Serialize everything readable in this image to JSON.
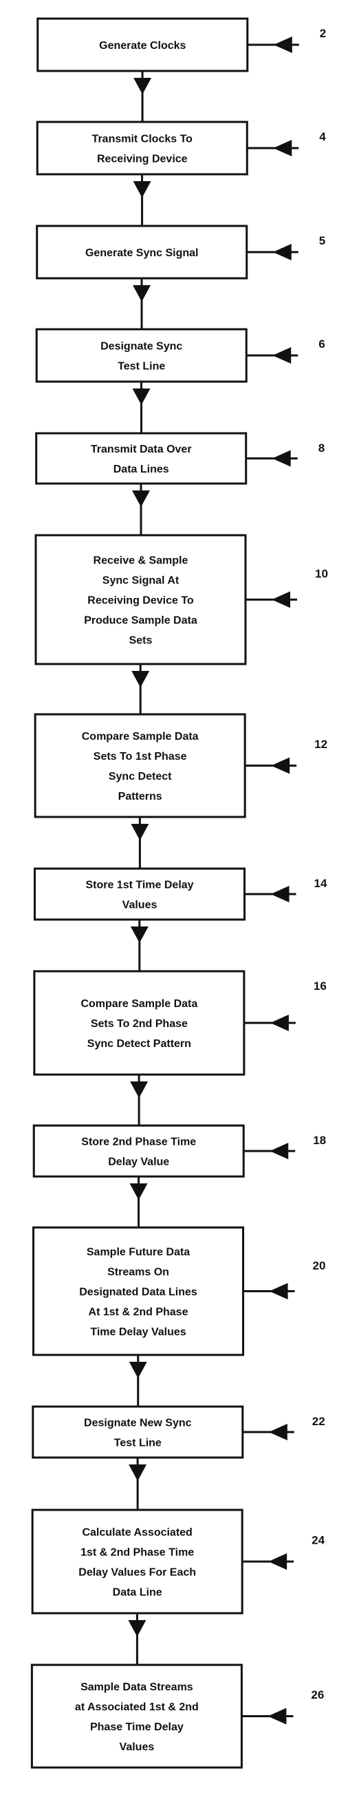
{
  "diagram": {
    "type": "flowchart",
    "direction": "top-to-bottom",
    "colors": {
      "stroke": "#111111",
      "background": "#ffffff",
      "text": "#111111"
    },
    "steps": [
      {
        "ref": "2",
        "lines": [
          "Generate Clocks"
        ]
      },
      {
        "ref": "4",
        "lines": [
          "Transmit Clocks To",
          "Receiving Device"
        ]
      },
      {
        "ref": "5",
        "lines": [
          "Generate Sync Signal"
        ]
      },
      {
        "ref": "6",
        "lines": [
          "Designate Sync",
          "Test Line"
        ]
      },
      {
        "ref": "8",
        "lines": [
          "Transmit Data Over",
          "Data Lines"
        ]
      },
      {
        "ref": "10",
        "lines": [
          "Receive & Sample",
          "Sync Signal At",
          "Receiving Device To",
          "Produce Sample Data",
          "Sets"
        ]
      },
      {
        "ref": "12",
        "lines": [
          "Compare Sample Data",
          "Sets To 1st Phase",
          "Sync Detect",
          "Patterns"
        ]
      },
      {
        "ref": "14",
        "lines": [
          "Store 1st Time Delay",
          "Values"
        ]
      },
      {
        "ref": "16",
        "lines": [
          "Compare Sample Data",
          "Sets To 2nd Phase",
          "Sync Detect Pattern"
        ]
      },
      {
        "ref": "18",
        "lines": [
          "Store 2nd Phase Time",
          "Delay Value"
        ]
      },
      {
        "ref": "20",
        "lines": [
          "Sample Future Data",
          "Streams On",
          "Designated Data Lines",
          "At 1st & 2nd Phase",
          "Time Delay Values"
        ]
      },
      {
        "ref": "22",
        "lines": [
          "Designate New Sync",
          "Test Line"
        ]
      },
      {
        "ref": "24",
        "lines": [
          "Calculate Associated",
          "1st & 2nd Phase Time",
          "Delay Values For Each",
          "Data Line"
        ]
      },
      {
        "ref": "26",
        "lines": [
          "Sample Data Streams",
          "at Associated 1st & 2nd",
          "Phase Time Delay",
          "Values"
        ]
      }
    ]
  }
}
